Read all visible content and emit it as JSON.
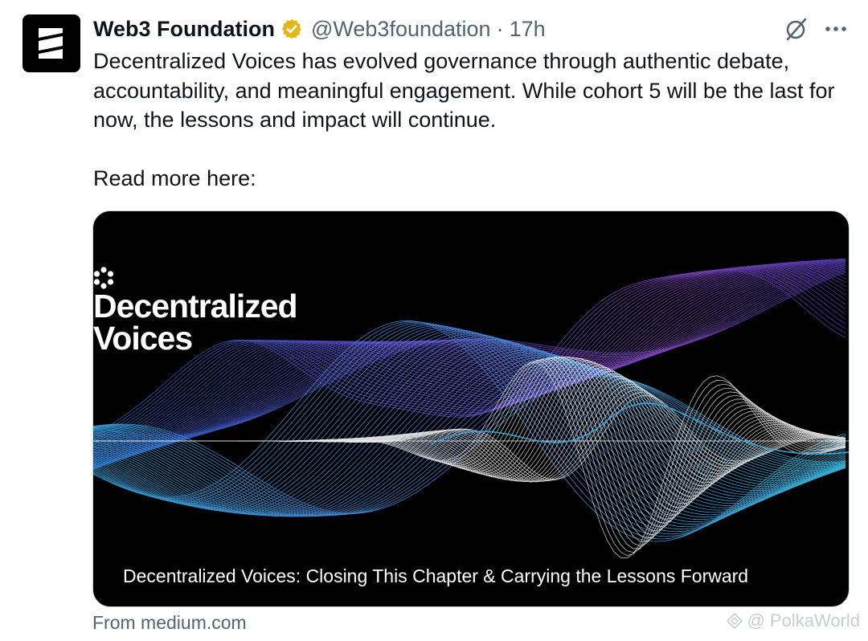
{
  "author": {
    "name": "Web3 Foundation",
    "handle": "@Web3foundation",
    "separator": "·",
    "time": "17h",
    "avatar_icon": "web3-foundation-logo",
    "verified_icon": "gold-verified-badge",
    "verified_color": "#e2b719"
  },
  "actions": {
    "grok_icon": "grok-slash-icon",
    "more_icon": "more-dots-icon",
    "more_label": "•••"
  },
  "tweet": {
    "paragraphs": [
      "Decentralized Voices has evolved governance through authentic debate, accountability, and meaningful engagement. While cohort 5 will be the last for now, the lessons and impact will continue.",
      "Read more here:"
    ]
  },
  "card": {
    "brand_line1": "Decentralized",
    "brand_line2": "Voices",
    "title": "Decentralized Voices: Closing This Chapter & Carrying the Lessons Forward",
    "source": "From medium.com",
    "colors": {
      "background": "#000000",
      "purple": "#7b4fd6",
      "blue": "#3aa8e0",
      "white": "#ffffff"
    }
  },
  "watermark": {
    "text": "@ PolkaWorld"
  }
}
